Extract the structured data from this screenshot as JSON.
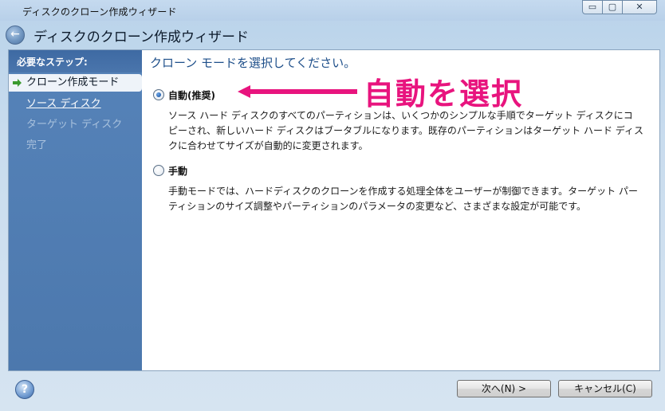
{
  "window": {
    "title": "ディスクのクローン作成ウィザード",
    "min_glyph": "▭",
    "max_glyph": "▢",
    "close_glyph": "✕"
  },
  "header": {
    "back_icon_glyph": "←",
    "title": "ディスクのクローン作成ウィザード"
  },
  "sidebar": {
    "heading": "必要なステップ:",
    "steps": [
      {
        "label": "クローン作成モード",
        "state": "current"
      },
      {
        "label": "ソース ディスク",
        "state": "link"
      },
      {
        "label": "ターゲット ディスク",
        "state": "disabled"
      },
      {
        "label": "完了",
        "state": "disabled"
      }
    ]
  },
  "content": {
    "prompt": "クローン モードを選択してください。",
    "options": [
      {
        "label": "自動(推奨)",
        "checked": true,
        "description_lines": [
          "ソース ハード ディスクのすべてのパーティションは、いくつかのシンプルな手順でターゲット ディスクにコ",
          "ピーされ、新しいハード ディスクはブータブルになります。既存のパーティションはターゲット ハード ディス",
          "クに合わせてサイズが自動的に変更されます。"
        ]
      },
      {
        "label": "手動",
        "checked": false,
        "description_lines": [
          "手動モードでは、ハードディスクのクローンを作成する処理全体をユーザーが制御できます。ターゲット パー",
          "ティションのサイズ調整やパーティションのパラメータの変更など、さまざまな設定が可能です。"
        ]
      }
    ],
    "annotation": {
      "text": "自動を選択",
      "color": "#e8147e"
    }
  },
  "footer": {
    "help_glyph": "?",
    "next_label": "次へ(N) >",
    "cancel_label": "キャンセル(C)"
  }
}
